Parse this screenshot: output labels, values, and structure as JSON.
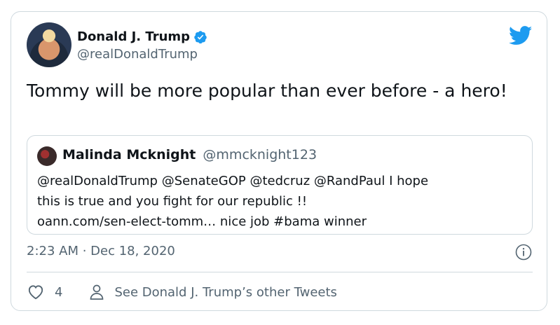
{
  "tweet": {
    "author_name": "Donald J. Trump",
    "author_handle": "@realDonaldTrump",
    "text": "Tommy will be more popular than ever before - a hero!",
    "timestamp": "2:23 AM · Dec 18, 2020",
    "likes": "4",
    "see_other": "See Donald J. Trump’s other Tweets"
  },
  "quoted": {
    "author_name": "Malinda Mcknight",
    "author_handle": "@mmcknight123",
    "text_line1": "@realDonaldTrump @SenateGOP @tedcruz @RandPaul I hope",
    "text_line2": "this is true and you fight for our republic !!",
    "text_line3": "oann.com/sen-elect-tomm…  nice job #bama winner"
  },
  "icons": {
    "verified": "verified-badge-icon",
    "bird": "twitter-bird-icon",
    "info": "info-icon",
    "heart": "heart-icon",
    "person": "person-icon"
  },
  "colors": {
    "brand": "#1d9bf0",
    "text": "#0f1419",
    "secondary": "#536471",
    "border": "#cfd9de"
  }
}
